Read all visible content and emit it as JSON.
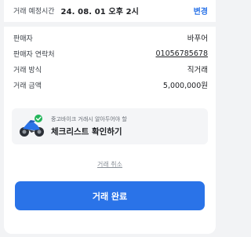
{
  "header": {
    "time_label": "거래 예정시간",
    "time_value": "24. 08. 01 오후 2시",
    "change_label": "변경"
  },
  "info": [
    {
      "key": "판매자",
      "value": "바푸어"
    },
    {
      "key": "판매자 연락처",
      "value": "01056785678"
    },
    {
      "key": "거래 방식",
      "value": "직거래"
    },
    {
      "key": "거래 금액",
      "value": "5,000,000원"
    }
  ],
  "banner": {
    "subtitle": "중고바이크 거래시 알아두어야 할",
    "title": "체크리스트 확인하기",
    "icon": "motorcycle-check-icon"
  },
  "cancel_label": "거래 취소",
  "complete_label": "거래 완료",
  "colors": {
    "accent": "#2a73e8",
    "check_green": "#22b55a",
    "background": "#f2f3f5"
  }
}
